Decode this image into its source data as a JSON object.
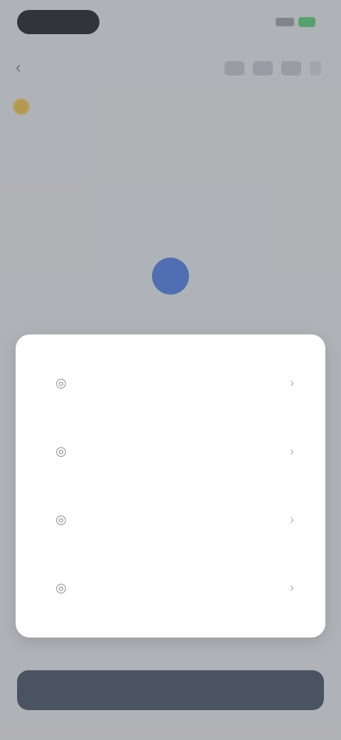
{
  "header": {
    "back_label": "‹"
  },
  "account": {
    "name": ""
  },
  "tabs": [
    {
      "label": ""
    },
    {
      "label": ""
    },
    {
      "label": ""
    },
    {
      "label": ""
    },
    {
      "label": ""
    },
    {
      "label": ""
    }
  ],
  "sheet": {
    "options": [
      {
        "icon": "option-icon-1",
        "title": "",
        "description": ""
      },
      {
        "icon": "option-icon-2",
        "title": "",
        "description": ""
      },
      {
        "icon": "option-icon-3",
        "title": "",
        "description": ""
      },
      {
        "icon": "option-icon-4",
        "title": "",
        "description": ""
      }
    ]
  },
  "primary_button": {
    "label": ""
  },
  "colors": {
    "accent": "#4f7fe6",
    "button": "#4a5361",
    "coin": "#f0c24a",
    "battery": "#5bcf7a"
  }
}
